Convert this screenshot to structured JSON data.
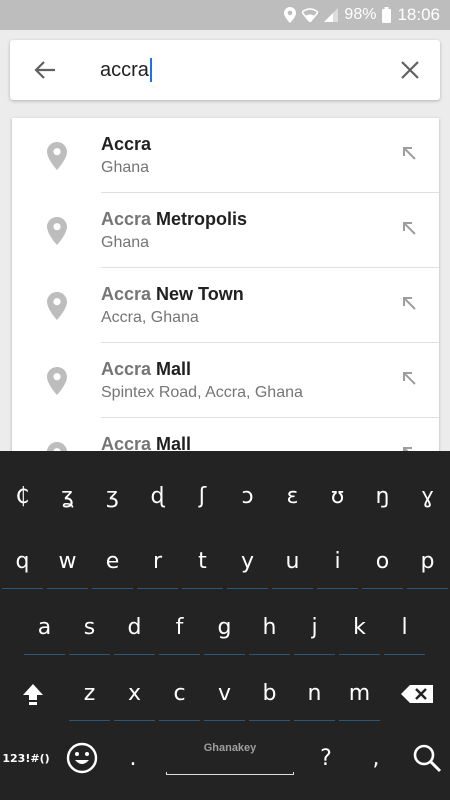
{
  "status_bar": {
    "battery": "98%",
    "time": "18:06"
  },
  "search": {
    "query": "accra"
  },
  "results": [
    {
      "match": "Accra",
      "rest": "",
      "subtitle": "Ghana"
    },
    {
      "match": "Accra",
      "rest": " Metropolis",
      "subtitle": "Ghana"
    },
    {
      "match": "Accra",
      "rest": " New Town",
      "subtitle": "Accra, Ghana"
    },
    {
      "match": "Accra",
      "rest": " Mall",
      "subtitle": "Spintex Road, Accra, Ghana"
    },
    {
      "match": "Accra",
      "rest": " Mall",
      "subtitle": ""
    }
  ],
  "keyboard": {
    "special_row": [
      "₵",
      "ʓ",
      "ʒ",
      "ɖ",
      "ʃ",
      "ɔ",
      "ɛ",
      "ʊ",
      "ŋ",
      "ɣ"
    ],
    "row1": [
      "q",
      "w",
      "e",
      "r",
      "t",
      "y",
      "u",
      "i",
      "o",
      "p"
    ],
    "row2": [
      "a",
      "s",
      "d",
      "f",
      "g",
      "h",
      "j",
      "k",
      "l"
    ],
    "row3": [
      "z",
      "x",
      "c",
      "v",
      "b",
      "n",
      "m"
    ],
    "symbols_label": "123!#()",
    "period": ".",
    "space_label": "Ghanakey",
    "question": "?",
    "comma": ","
  },
  "icons": {
    "back": "arrow-left-icon",
    "clear": "close-icon",
    "pin": "map-pin-icon",
    "fill": "arrow-up-left-icon",
    "shift": "shift-icon",
    "backspace": "backspace-icon",
    "emoji": "emoji-icon",
    "search": "search-icon"
  },
  "colors": {
    "accent": "#1a73e8",
    "keyboard_bg": "#232323",
    "status_bar_bg": "#bdbdbd"
  }
}
